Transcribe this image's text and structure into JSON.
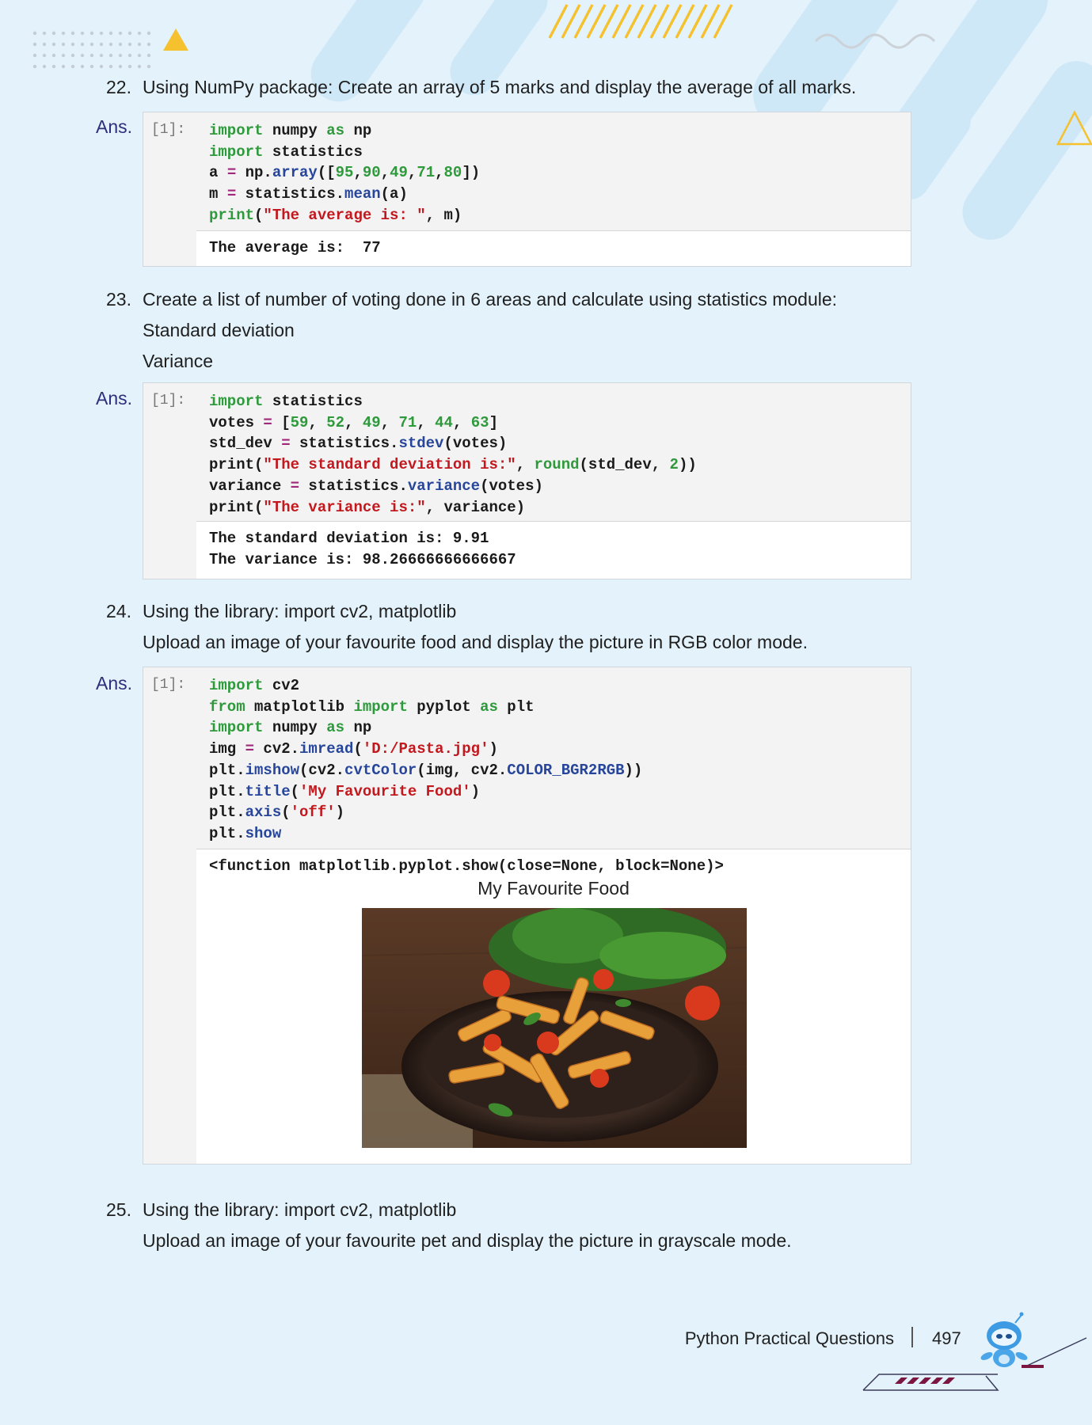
{
  "questions": [
    {
      "number": "22.",
      "lines": [
        "Using NumPy package: Create an array of 5 marks and display the average of all marks."
      ]
    },
    {
      "number": "23.",
      "lines": [
        "Create a list of number of voting done in 6 areas and calculate using statistics module:",
        "Standard deviation",
        "Variance"
      ]
    },
    {
      "number": "24.",
      "lines": [
        "Using the library: import cv2, matplotlib",
        "Upload an image of your favourite food and display the picture in RGB color mode."
      ]
    },
    {
      "number": "25.",
      "lines": [
        "Using the library: import cv2, matplotlib",
        "Upload an image of your favourite pet and display the picture in grayscale mode."
      ]
    }
  ],
  "ans_label": "Ans.",
  "cells": [
    {
      "prompt": "[1]:",
      "code": [
        "import numpy as np",
        "import statistics",
        "a = np.array([95,90,49,71,80])",
        "m = statistics.mean(a)",
        "print(\"The average is: \", m)"
      ],
      "output": [
        "The average is:  77"
      ]
    },
    {
      "prompt": "[1]:",
      "code": [
        "import statistics",
        "votes = [59, 52, 49, 71, 44, 63]",
        "std_dev = statistics.stdev(votes)",
        "print(\"The standard deviation is:\", round(std_dev, 2))",
        "variance = statistics.variance(votes)",
        "print(\"The variance is:\", variance)"
      ],
      "output": [
        "The standard deviation is: 9.91",
        "The variance is: 98.26666666666667"
      ]
    },
    {
      "prompt": "[1]:",
      "code": [
        "import cv2",
        "from matplotlib import pyplot as plt",
        "import numpy as np",
        "img = cv2.imread('D:/Pasta.jpg')",
        "plt.imshow(cv2.cvtColor(img, cv2.COLOR_BGR2RGB))",
        "plt.title('My Favourite Food')",
        "plt.axis('off')",
        "plt.show"
      ],
      "output": [
        "<function matplotlib.pyplot.show(close=None, block=None)>"
      ],
      "figure_title": "My Favourite Food"
    }
  ],
  "footer": {
    "title": "Python Practical Questions",
    "page_number": "497"
  },
  "colors": {
    "page_bg": "#e3f2fb",
    "keyword": "#2e9a3c",
    "string": "#c2181e",
    "function": "#27469b",
    "accent_yellow": "#f5c12e"
  }
}
